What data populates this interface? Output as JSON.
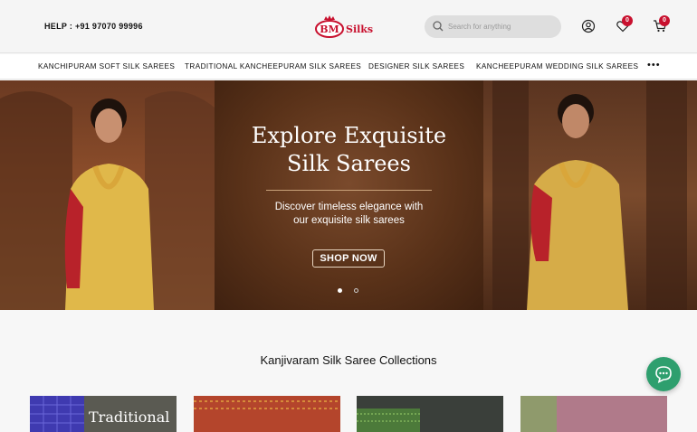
{
  "header": {
    "help_text": "HELP : +91 97070 99996",
    "logo_mark": "BM",
    "logo_word": "Silks",
    "search_placeholder": "Search for anything",
    "wishlist_count": "0",
    "cart_count": "0"
  },
  "nav": {
    "items": [
      {
        "label": "KANCHIPURAM SOFT SILK SAREES"
      },
      {
        "label": "TRADITIONAL KANCHEEPURAM SILK SAREES"
      },
      {
        "label": "DESIGNER SILK SAREES"
      },
      {
        "label": "KANCHEEPURAM WEDDING SILK SAREES"
      }
    ],
    "more_label": "•••"
  },
  "hero": {
    "title_line1": "Explore Exquisite",
    "title_line2": "Silk Sarees",
    "subtitle": "Discover timeless elegance with our exquisite silk sarees",
    "cta_label": "SHOP NOW",
    "slide_count": 2,
    "active_slide": 1
  },
  "collections": {
    "title": "Kanjivaram Silk Saree Collections",
    "cards": [
      {
        "label": "Traditional"
      },
      {
        "label": ""
      },
      {
        "label": ""
      },
      {
        "label": ""
      }
    ]
  },
  "icons": {
    "search": "search-icon",
    "user": "user-icon",
    "wishlist": "heart-icon",
    "cart": "cart-icon",
    "chat": "chat-icon"
  },
  "colors": {
    "accent": "#c8102e",
    "chat": "#2e9f6e"
  }
}
